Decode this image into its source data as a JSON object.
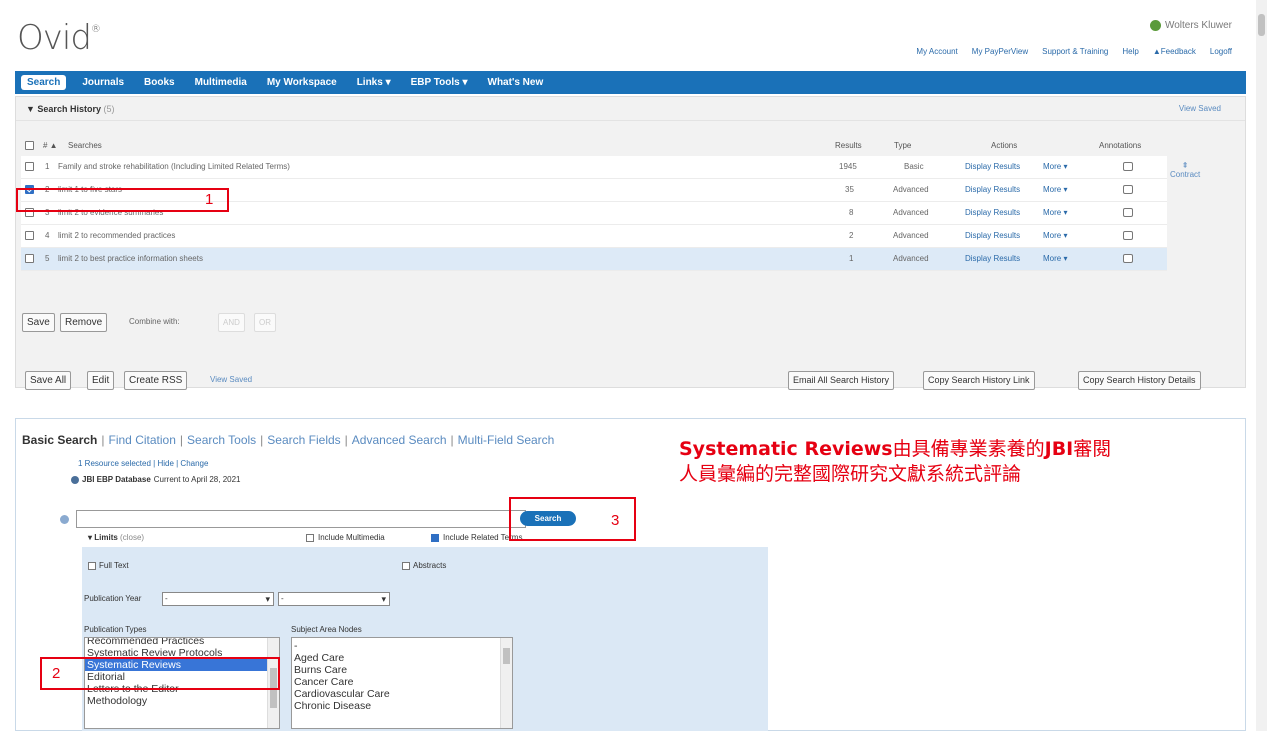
{
  "header": {
    "logo": "Ovid",
    "logo_mark": "®",
    "brand": "Wolters Kluwer",
    "links": [
      "My Account",
      "My PayPerView",
      "Support & Training",
      "Help",
      "Feedback",
      "Logoff"
    ]
  },
  "nav": {
    "items": [
      "Search",
      "Journals",
      "Books",
      "Multimedia",
      "My Workspace",
      "Links ▾",
      "EBP Tools ▾",
      "What's New"
    ]
  },
  "search_history": {
    "title": "Search History",
    "count": "(5)",
    "view_saved": "View Saved",
    "columns": {
      "num": "# ▲",
      "searches": "Searches",
      "results": "Results",
      "type": "Type",
      "actions": "Actions",
      "annotations": "Annotations"
    },
    "rows": [
      {
        "num": "1",
        "search": "Family and stroke rehabilitation (Including Limited Related Terms)",
        "results": "1945",
        "type": "Basic",
        "display": "Display Results",
        "more": "More ▾"
      },
      {
        "num": "2",
        "search": "limit 1 to five stars",
        "results": "35",
        "type": "Advanced",
        "display": "Display Results",
        "more": "More ▾"
      },
      {
        "num": "3",
        "search": "limit 2 to evidence summaries",
        "results": "8",
        "type": "Advanced",
        "display": "Display Results",
        "more": "More ▾"
      },
      {
        "num": "4",
        "search": "limit 2 to recommended practices",
        "results": "2",
        "type": "Advanced",
        "display": "Display Results",
        "more": "More ▾"
      },
      {
        "num": "5",
        "search": "limit 2 to best practice information sheets",
        "results": "1",
        "type": "Advanced",
        "display": "Display Results",
        "more": "More ▾"
      }
    ],
    "contract": "Contract",
    "save": "Save",
    "remove": "Remove",
    "combine_with": "Combine with:",
    "and": "AND",
    "or": "OR",
    "save_all": "Save All",
    "edit": "Edit",
    "create_rss": "Create RSS",
    "view_saved_bottom": "View Saved",
    "email_all": "Email All Search History",
    "copy_link": "Copy Search History Link",
    "copy_details": "Copy Search History Details"
  },
  "basic_search": {
    "tabs": [
      "Basic Search",
      "Find Citation",
      "Search Tools",
      "Search Fields",
      "Advanced Search",
      "Multi-Field Search"
    ],
    "resource_selected": "1 Resource selected | Hide | Change",
    "database": "JBI EBP Database",
    "database_current": "Current to April 28, 2021",
    "search_value": "",
    "search_button": "Search",
    "limits": "Limits",
    "limits_mode": "(close)",
    "include_multimedia": "Include Multimedia",
    "include_related": "Include Related Terms",
    "full_text": "Full Text",
    "abstracts": "Abstracts",
    "publication_year": "Publication Year",
    "year_from": "-",
    "year_to": "-",
    "publication_types_label": "Publication Types",
    "publication_types": [
      "Recommended Practices",
      "Systematic Review Protocols",
      "Systematic Reviews",
      "Editorial",
      "Letters to the Editor",
      "Methodology"
    ],
    "subject_area_label": "Subject Area Nodes",
    "subject_areas": [
      "-",
      "Aged Care",
      "Burns Care",
      "Cancer Care",
      "Cardiovascular Care",
      "Chronic Disease"
    ]
  },
  "annotations": {
    "n1": "1",
    "n2": "2",
    "n3": "3",
    "note_line1_a": "Systematic Reviews",
    "note_line1_b": "由具備專業素養的",
    "note_line1_c": "JBI",
    "note_line1_d": "審閱",
    "note_line2": "人員彙編的完整國際研究文獻系統式評論"
  },
  "colors": {
    "nav": "#1a71b8",
    "annotation_red": "#e60012",
    "selected_row": "#ddeaf7"
  }
}
